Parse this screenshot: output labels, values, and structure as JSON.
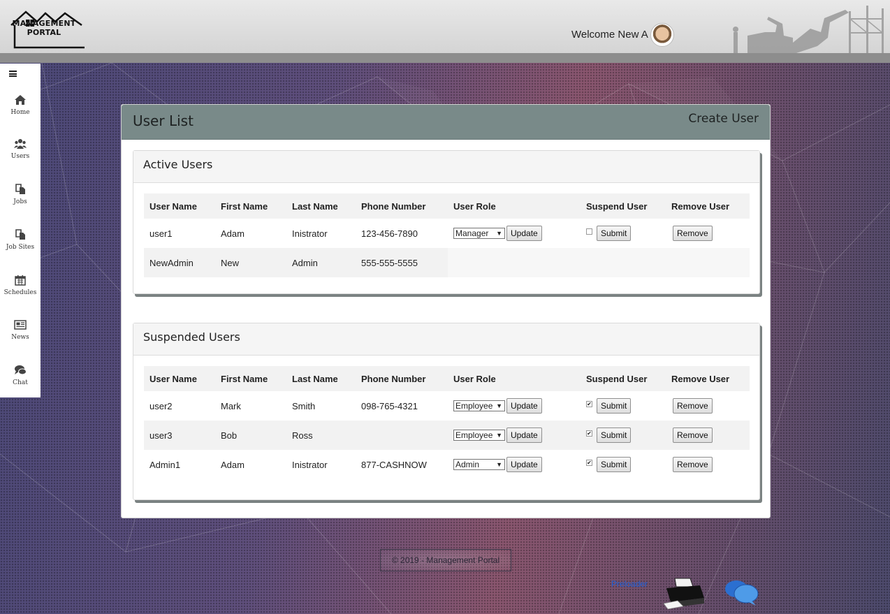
{
  "header": {
    "logo_text_line1": "MANAGEMENT",
    "logo_text_line2": "PORTAL",
    "welcome": "Welcome New A"
  },
  "sidebar": {
    "items": [
      {
        "label": "Home",
        "icon": "home-icon"
      },
      {
        "label": "Users",
        "icon": "users-icon"
      },
      {
        "label": "Jobs",
        "icon": "file-icon"
      },
      {
        "label": "Job Sites",
        "icon": "file-icon"
      },
      {
        "label": "Schedules",
        "icon": "calendar-icon"
      },
      {
        "label": "News",
        "icon": "newspaper-icon"
      },
      {
        "label": "Chat",
        "icon": "chat-icon"
      }
    ]
  },
  "panel": {
    "title": "User List",
    "create_user": "Create User"
  },
  "columns": [
    "User Name",
    "First Name",
    "Last Name",
    "Phone Number",
    "User Role",
    "Suspend User",
    "Remove User"
  ],
  "active": {
    "title": "Active Users",
    "rows": [
      {
        "username": "user1",
        "first": "Adam",
        "last": "Inistrator",
        "phone": "123-456-7890",
        "role": "Manager",
        "suspended": false,
        "has_controls": true
      },
      {
        "username": "NewAdmin",
        "first": "New",
        "last": "Admin",
        "phone": "555-555-5555",
        "has_controls": false
      }
    ]
  },
  "suspended": {
    "title": "Suspended Users",
    "rows": [
      {
        "username": "user2",
        "first": "Mark",
        "last": "Smith",
        "phone": "098-765-4321",
        "role": "Employee",
        "suspended": true,
        "has_controls": true
      },
      {
        "username": "user3",
        "first": "Bob",
        "last": "Ross",
        "phone": "",
        "role": "Employee",
        "suspended": true,
        "has_controls": true
      },
      {
        "username": "Admin1",
        "first": "Adam",
        "last": "Inistrator",
        "phone": "877-CASHNOW",
        "role": "Admin",
        "suspended": true,
        "has_controls": true
      }
    ]
  },
  "buttons": {
    "update": "Update",
    "submit": "Submit",
    "remove": "Remove"
  },
  "footer": {
    "copyright": "© 2019 - Management Portal",
    "preloader": "Preloader"
  },
  "colors": {
    "panel_header": "#798a89",
    "sidebar_bg": "#ffffff",
    "header_bar": "#8d8d8d",
    "link_blue": "#1f5fd6"
  }
}
